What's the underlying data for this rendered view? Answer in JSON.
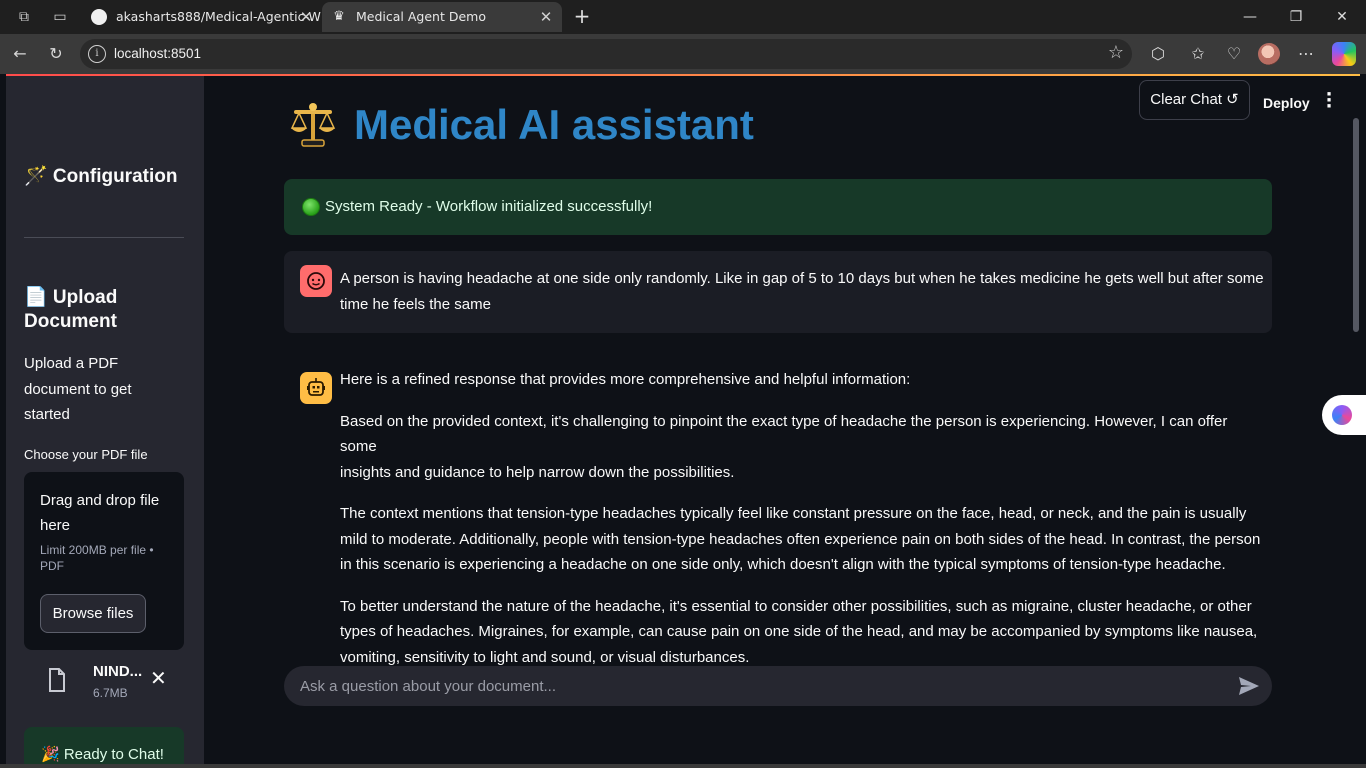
{
  "browser": {
    "tabs": [
      {
        "title": "akasharts888/Medical-Agentic-W",
        "icon": "github-icon",
        "active": false
      },
      {
        "title": "Medical Agent Demo",
        "icon": "streamlit-crown-icon",
        "active": true
      }
    ],
    "url": "localhost:8501"
  },
  "sidebar": {
    "configuration_heading": "🪄 Configuration",
    "upload_heading_line1": "📄 Upload",
    "upload_heading_line2": "Document",
    "upload_help_line1": "Upload a PDF",
    "upload_help_line2": "document to get",
    "upload_help_line3": "started",
    "file_label": "Choose your PDF file",
    "dropzone_title_line1": "Drag and drop file",
    "dropzone_title_line2": "here",
    "dropzone_limit_line1": "Limit 200MB per file •",
    "dropzone_limit_line2": "PDF",
    "browse_label": "Browse files",
    "uploaded_file": {
      "name": "NIND...",
      "size": "6.7MB"
    },
    "ready_message": "🎉 Ready to Chat!"
  },
  "header": {
    "clear_chat_label": "Clear Chat ↺",
    "deploy_label": "Deploy"
  },
  "main": {
    "title": "Medical AI assistant",
    "title_icon": "scales-icon",
    "status_message": "System Ready - Workflow initialized successfully!",
    "messages": [
      {
        "role": "user",
        "line1": "A person is having headache at one side only randomly. Like in gap of 5 to 10 days but when he takes medicine he gets well but after some",
        "line2": "time he feels the same"
      },
      {
        "role": "assistant",
        "p1": "Here is a refined response that provides more comprehensive and helpful information:",
        "p2_line1": "Based on the provided context, it's challenging to pinpoint the exact type of headache the person is experiencing. However, I can offer some",
        "p2_line2": "insights and guidance to help narrow down the possibilities.",
        "p3_line1": "The context mentions that tension-type headaches typically feel like constant pressure on the face, head, or neck, and the pain is usually",
        "p3_line2": "mild to moderate. Additionally, people with tension-type headaches often experience pain on both sides of the head. In contrast, the person",
        "p3_line3": "in this scenario is experiencing a headache on one side only, which doesn't align with the typical symptoms of tension-type headache.",
        "p4_line1": "To better understand the nature of the headache, it's essential to consider other possibilities, such as migraine, cluster headache, or other",
        "p4_line2": "types of headaches. Migraines, for example, can cause pain on one side of the head, and may be accompanied by symptoms like nausea,",
        "p4_line3": "vomiting, sensitivity to light and sound, or visual disturbances."
      }
    ],
    "chat_placeholder": "Ask a question about your document..."
  },
  "colors": {
    "accent": "#ff4b4b",
    "title": "#2f86c7",
    "success_bg": "#173928",
    "background": "#0e1117",
    "sidebar_bg": "#262730"
  }
}
